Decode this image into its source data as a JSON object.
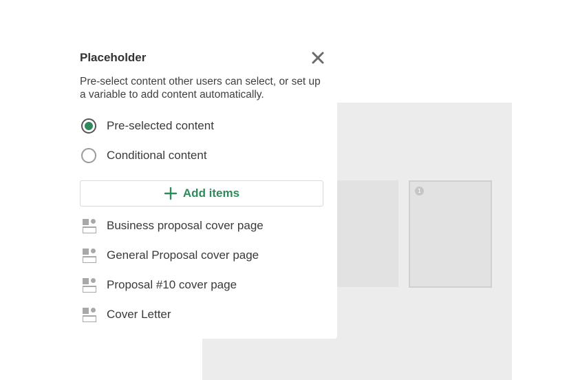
{
  "panel": {
    "title": "Placeholder",
    "close_icon": "close-icon",
    "description": "Pre-select content other users can select, or set up a variable to add content automatically."
  },
  "options": [
    {
      "label": "Pre-selected content",
      "selected": true
    },
    {
      "label": "Conditional content",
      "selected": false
    }
  ],
  "add_items": {
    "label": "Add items",
    "icon": "plus-icon"
  },
  "items": [
    {
      "label": "Business proposal cover page",
      "icon": "layout-block-icon"
    },
    {
      "label": "General Proposal cover page",
      "icon": "layout-block-icon"
    },
    {
      "label": "Proposal #10 cover page",
      "icon": "layout-block-icon"
    },
    {
      "label": "Cover Letter",
      "icon": "layout-block-icon"
    }
  ],
  "canvas": {
    "badge": "1"
  },
  "colors": {
    "accent": "#2e8a5c",
    "canvas": "#ececec",
    "thumbnail": "#e2e2e2"
  }
}
